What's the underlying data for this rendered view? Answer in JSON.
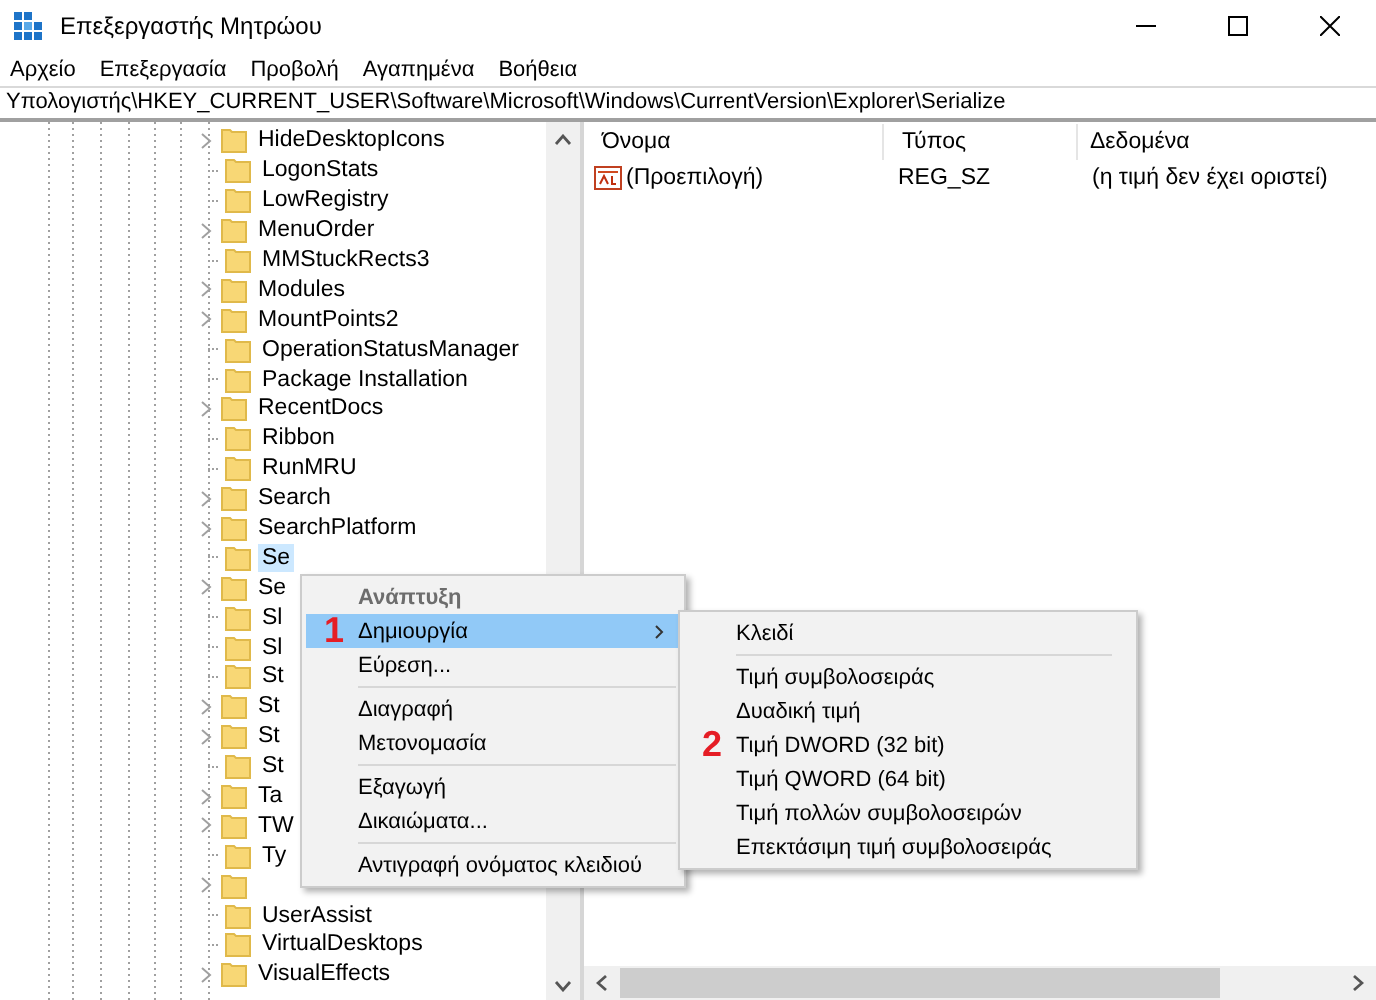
{
  "window": {
    "title": "Επεξεργαστής Μητρώου"
  },
  "menu_bar": [
    "Αρχείο",
    "Επεξεργασία",
    "Προβολή",
    "Αγαπημένα",
    "Βοήθεια"
  ],
  "address": "Υπολογιστής\\HKEY_CURRENT_USER\\Software\\Microsoft\\Windows\\CurrentVersion\\Explorer\\Serialize",
  "tree": {
    "items": [
      {
        "label": "HideDesktopIcons",
        "expandable": true,
        "selected": false
      },
      {
        "label": "LogonStats",
        "expandable": false,
        "selected": false
      },
      {
        "label": "LowRegistry",
        "expandable": false,
        "selected": false
      },
      {
        "label": "MenuOrder",
        "expandable": true,
        "selected": false
      },
      {
        "label": "MMStuckRects3",
        "expandable": false,
        "selected": false
      },
      {
        "label": "Modules",
        "expandable": true,
        "selected": false
      },
      {
        "label": "MountPoints2",
        "expandable": true,
        "selected": false
      },
      {
        "label": "OperationStatusManager",
        "expandable": false,
        "selected": false
      },
      {
        "label": "Package Installation",
        "expandable": false,
        "selected": false
      },
      {
        "label": "RecentDocs",
        "expandable": true,
        "selected": false
      },
      {
        "label": "Ribbon",
        "expandable": false,
        "selected": false
      },
      {
        "label": "RunMRU",
        "expandable": false,
        "selected": false
      },
      {
        "label": "Search",
        "expandable": true,
        "selected": false
      },
      {
        "label": "SearchPlatform",
        "expandable": true,
        "selected": false
      },
      {
        "label": "Se",
        "expandable": false,
        "selected": true
      },
      {
        "label": "Se",
        "expandable": true,
        "selected": false
      },
      {
        "label": "Sl",
        "expandable": false,
        "selected": false
      },
      {
        "label": "Sl",
        "expandable": false,
        "selected": false
      },
      {
        "label": "St",
        "expandable": false,
        "selected": false
      },
      {
        "label": "St",
        "expandable": true,
        "selected": false
      },
      {
        "label": "St",
        "expandable": true,
        "selected": false
      },
      {
        "label": "St",
        "expandable": false,
        "selected": false
      },
      {
        "label": "Ta",
        "expandable": true,
        "selected": false
      },
      {
        "label": "TW",
        "expandable": true,
        "selected": false
      },
      {
        "label": "Ty",
        "expandable": false,
        "selected": false
      },
      {
        "expandable": true
      },
      {
        "label": "UserAssist",
        "expandable": false,
        "selected": false
      },
      {
        "label": "VirtualDesktops",
        "expandable": false,
        "selected": false
      },
      {
        "label": "VisualEffects",
        "expandable": true,
        "selected": false
      }
    ]
  },
  "values_table": {
    "columns": [
      "Όνομα",
      "Τύπος",
      "Δεδομένα"
    ],
    "rows": [
      {
        "kind": "string",
        "name": "(Προεπιλογή)",
        "type": "REG_SZ",
        "data": "(η τιμή δεν έχει οριστεί)"
      }
    ]
  },
  "context_menu": {
    "items": [
      {
        "kind": "item",
        "label": "Ανάπτυξη",
        "disabled": true,
        "selected": false,
        "submenu": false
      },
      {
        "kind": "item",
        "label": "Δημιουργία",
        "disabled": false,
        "selected": true,
        "submenu": true,
        "annotation": "1"
      },
      {
        "kind": "item",
        "label": "Εύρεση...",
        "disabled": false,
        "selected": false,
        "submenu": false
      },
      {
        "kind": "separator"
      },
      {
        "kind": "item",
        "label": "Διαγραφή",
        "disabled": false,
        "selected": false,
        "submenu": false
      },
      {
        "kind": "item",
        "label": "Μετονομασία",
        "disabled": false,
        "selected": false,
        "submenu": false
      },
      {
        "kind": "separator"
      },
      {
        "kind": "item",
        "label": "Εξαγωγή",
        "disabled": false,
        "selected": false,
        "submenu": false
      },
      {
        "kind": "item",
        "label": "Δικαιώματα...",
        "disabled": false,
        "selected": false,
        "submenu": false
      },
      {
        "kind": "separator"
      },
      {
        "kind": "item",
        "label": "Αντιγραφή ονόματος κλειδιού",
        "disabled": false,
        "selected": false,
        "submenu": false
      }
    ]
  },
  "submenu": {
    "items": [
      {
        "kind": "item",
        "label": "Κλειδί"
      },
      {
        "kind": "separator"
      },
      {
        "kind": "item",
        "label": "Τιμή συμβολοσειράς"
      },
      {
        "kind": "item",
        "label": "Δυαδική τιμή"
      },
      {
        "kind": "item",
        "label": "Τιμή DWORD (32 bit)",
        "annotation": "2"
      },
      {
        "kind": "item",
        "label": "Τιμή QWORD (64 bit)"
      },
      {
        "kind": "item",
        "label": "Τιμή πολλών συμβολοσειρών"
      },
      {
        "kind": "item",
        "label": "Επεκτάσιμη τιμή συμβολοσειράς"
      }
    ]
  }
}
